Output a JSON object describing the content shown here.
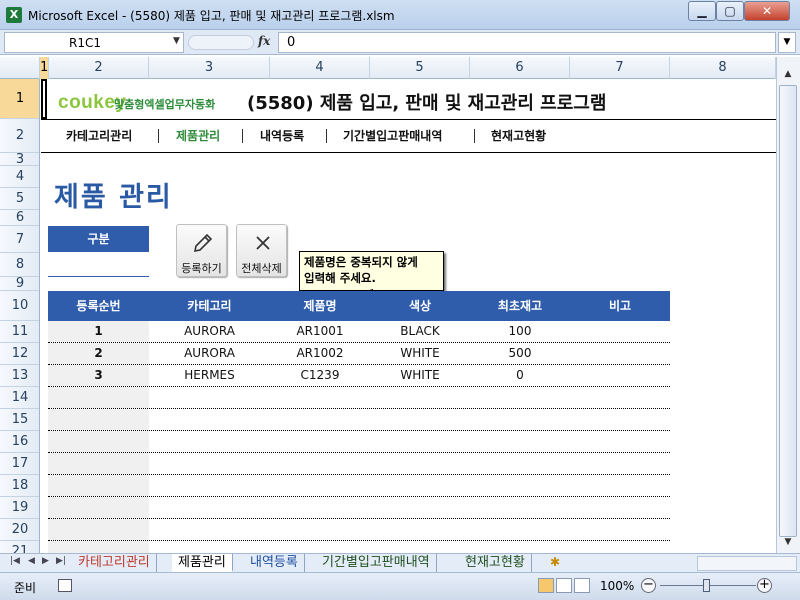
{
  "window": {
    "title": "Microsoft Excel - (5580) 제품 입고, 판매 및 재고관리 프로그램.xlsm",
    "app_icon": "X",
    "minimize": "▁",
    "maximize": "▢",
    "close": "✕"
  },
  "formula_bar": {
    "name_box": "R1C1",
    "fx_label": "fx",
    "value": "0"
  },
  "column_headers": [
    "1",
    "2",
    "3",
    "4",
    "5",
    "6",
    "7",
    "8"
  ],
  "row_headers": [
    "1",
    "2",
    "3",
    "4",
    "5",
    "6",
    "7",
    "8",
    "9",
    "10",
    "11",
    "12",
    "13",
    "14",
    "15",
    "16",
    "17",
    "18",
    "19",
    "20",
    "21"
  ],
  "header": {
    "logo": "coukey",
    "logo_sub": "맞춤형엑셀업무자동화",
    "title": "(5580) 제품 입고, 판매 및 재고관리 프로그램"
  },
  "nav": {
    "items": [
      "카테고리관리",
      "제품관리",
      "내역등록",
      "기간별입고판매내역",
      "현재고현황"
    ],
    "active_index": 1
  },
  "page_title": "제품 관리",
  "filter": {
    "label": "구분",
    "value": ""
  },
  "toolbar": {
    "register_label": "등록하기",
    "delete_all_label": "전체삭제"
  },
  "tooltip": "제품명은 중복되지 않게\n입력해 주세요.",
  "table": {
    "columns": [
      "등록순번",
      "카테고리",
      "제품명",
      "색상",
      "최초재고",
      "비고"
    ],
    "rows": [
      [
        "1",
        "AURORA",
        "AR1001",
        "BLACK",
        "100",
        ""
      ],
      [
        "2",
        "AURORA",
        "AR1002",
        "WHITE",
        "500",
        ""
      ],
      [
        "3",
        "HERMES",
        "C1239",
        "WHITE",
        "0",
        ""
      ]
    ]
  },
  "sheet_tabs": [
    "카테고리관리",
    "제품관리",
    "내역등록",
    "기간별입고판매내역",
    "현재고현황"
  ],
  "active_sheet_tab": 1,
  "status": {
    "ready": "준비",
    "zoom": "100%",
    "zoom_minus": "−",
    "zoom_plus": "+"
  },
  "colors": {
    "accent_blue": "#2f5dab",
    "nav_active_green": "#2e8b3a",
    "logo_green": "#8cc63f"
  }
}
